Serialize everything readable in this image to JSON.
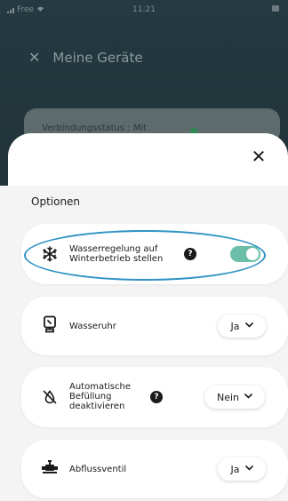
{
  "status_bar": {
    "carrier": "Free",
    "time": "11:21"
  },
  "background": {
    "header_title": "Meine Geräte",
    "card_text": "Verbindungsstatus : Mit"
  },
  "sheet": {
    "close_glyph": "✕",
    "section_title": "Optionen",
    "options": [
      {
        "label": "Wasserregelung auf Winterbetrieb stellen",
        "icon": "snowflake-icon",
        "control": "toggle",
        "enabled": true,
        "has_help": true
      },
      {
        "label": "Wasseruhr",
        "icon": "water-meter-icon",
        "control": "select",
        "value": "Ja",
        "has_help": false
      },
      {
        "label": "Automatische Befüllung deaktivieren",
        "icon": "no-refill-icon",
        "control": "select",
        "value": "Nein",
        "has_help": true
      },
      {
        "label": "Abflussventil",
        "icon": "drain-valve-icon",
        "control": "select",
        "value": "Ja",
        "has_help": false
      }
    ]
  },
  "colors": {
    "toggle_on": "#6bbfa8",
    "highlight": "#2f93c4",
    "background_dark": "#1f3036"
  }
}
